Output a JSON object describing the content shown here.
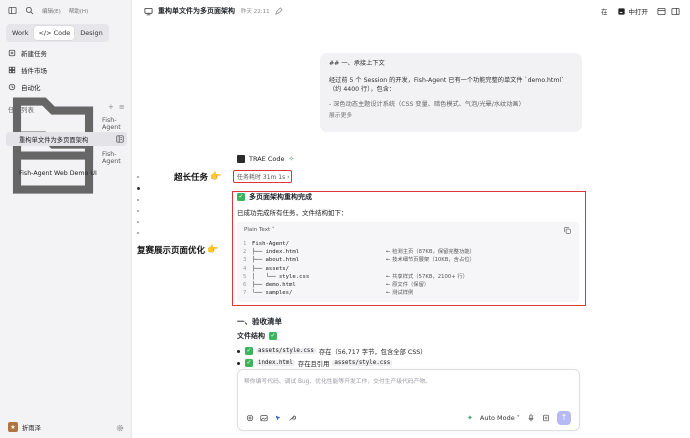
{
  "topbar": {
    "menu1": "编辑(E)",
    "menu2": "帮助(H)"
  },
  "modes": [
    {
      "label": "Work"
    },
    {
      "label": "</> Code"
    },
    {
      "label": "Design"
    }
  ],
  "nav": [
    {
      "label": "新建任务",
      "icon": "new-task-icon"
    },
    {
      "label": "插件市场",
      "icon": "plugin-icon"
    },
    {
      "label": "自动化",
      "icon": "automation-icon"
    }
  ],
  "task_section": {
    "title": "任务列表"
  },
  "groups": [
    {
      "name": "Fish-Agent",
      "items": [
        "重构单文件为多页面架构"
      ]
    },
    {
      "name": "Fish-Agent",
      "items": [
        "Fish-Agent Web Demo UI"
      ]
    }
  ],
  "user": {
    "name": "折雨泽",
    "avatar_char": "★"
  },
  "header": {
    "title": "重构单文件为多页面架构",
    "time": "昨天 22:11",
    "in_label": "在",
    "open_label": "中打开"
  },
  "user_message": {
    "heading": "## 一、承接上下文",
    "body": "经过前 5 个 Session 的开发，Fish-Agent 已有一个功能完整的单文件 `demo.html`（约 4400 行），包含：",
    "list": "- 深色动态主题设计系统（CSS 变量、暗色模式、气泡/光晕/水纹动画）",
    "more": "展示更多"
  },
  "assistant": {
    "name": "TRAE Code",
    "duration": "任务耗时 31m 1s ›",
    "done_title": "多页面架构重构完成",
    "para": "已成功完成所有任务，文件结构如下：",
    "code_lang": "Plain Text ˅",
    "code_lines": [
      {
        "n": "1",
        "t": "Fish-Agent/",
        "c": ""
      },
      {
        "n": "2",
        "t": "├── index.html",
        "c": "← 检测主页（87KB，保留完整功能）"
      },
      {
        "n": "3",
        "t": "├── about.html",
        "c": "← 技术细节页展架（10KB，含占位）"
      },
      {
        "n": "4",
        "t": "├── assets/",
        "c": ""
      },
      {
        "n": "5",
        "t": "│   └── style.css",
        "c": "← 共享样式（57KB，2100+ 行）"
      },
      {
        "n": "6",
        "t": "├── demo.html",
        "c": "← 原文件（保留）"
      },
      {
        "n": "7",
        "t": "└── samples/",
        "c": "← 测试样例"
      }
    ],
    "section_title": "一、验收清单",
    "sub_title": "文件结构",
    "bullets": [
      {
        "code": "assets/style.css",
        "text": " 存在（56,717 字节，包含全部 CSS）"
      },
      {
        "code": "index.html",
        "text": " 存在且引用 ",
        "code2": "assets/style.css"
      }
    ]
  },
  "annotations": {
    "long_task": "超长任务",
    "optimized": "复赛展示页面优化"
  },
  "composer": {
    "placeholder": "帮你编写代码、调试 Bug、优化性能等开发工作，交付生产级代码产物。",
    "mode": "Auto Mode"
  },
  "colors": {
    "accent_red": "#d9363e",
    "check_green": "#3eb35c",
    "send_button": "#b7b9f2"
  }
}
